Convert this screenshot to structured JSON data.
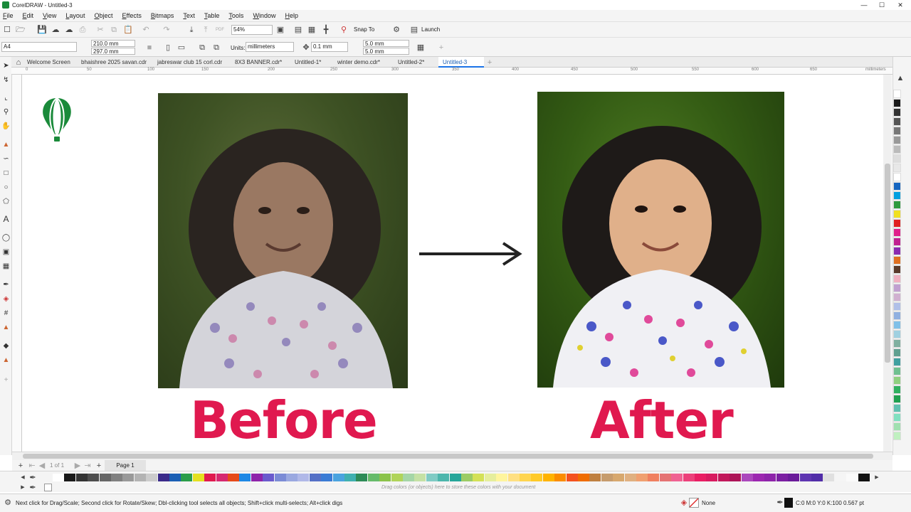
{
  "window": {
    "title": "CorelDRAW - Untitled-3",
    "min": "—",
    "max": "☐",
    "close": "✕"
  },
  "menu": [
    "File",
    "Edit",
    "View",
    "Layout",
    "Object",
    "Effects",
    "Bitmaps",
    "Text",
    "Table",
    "Tools",
    "Window",
    "Help"
  ],
  "stdbar": {
    "zoom": "54%",
    "snap_to": "Snap To",
    "launch": "Launch"
  },
  "propbar": {
    "page_size": "A4",
    "width": "210.0 mm",
    "height": "297.0 mm",
    "units_label": "Units:",
    "units": "millimeters",
    "nudge": "0.1 mm",
    "dup_x": "5.0 mm",
    "dup_y": "5.0 mm"
  },
  "tabs": [
    "Welcome Screen",
    "bhaishree 2025 savan.cdr",
    "jabreswar club 15 corl.cdr",
    "8X3 BANNER.cdr*",
    "Untitled-1*",
    "winter demo.cdr*",
    "Untitled-2*",
    "Untitled-3"
  ],
  "ruler": {
    "ticks": [
      "0",
      "50",
      "100",
      "150",
      "200",
      "250",
      "300",
      "350",
      "400",
      "450",
      "500",
      "550",
      "600",
      "650"
    ],
    "units": "millimeters"
  },
  "canvas": {
    "before": "Before",
    "after": "After"
  },
  "pagebar": {
    "counter": "1 of 1",
    "page": "Page 1"
  },
  "palette_hint": "Drag colors (or objects) here to store these colors with your document",
  "status": {
    "hint": "Next click for Drag/Scale; Second click for Rotate/Skew; Dbl-clicking tool selects all objects; Shift+click multi-selects; Alt+click digs",
    "fill": "None",
    "outline": "C:0 M:0 Y:0 K:100  0.567 pt"
  },
  "colors": {
    "accent": "#e0194f",
    "tab_active": "#1a73e8",
    "logo": "#1a8a3a"
  },
  "palette": [
    "#ffffff",
    "#1a1a1a",
    "#333333",
    "#4d4d4d",
    "#666666",
    "#808080",
    "#999999",
    "#b3b3b3",
    "#cccccc",
    "#3a2a8a",
    "#1a5fb4",
    "#2a9d4a",
    "#e5e020",
    "#e0194f",
    "#d62870",
    "#e64a19",
    "#1e88e5",
    "#8e24aa",
    "#6a5acd",
    "#7b8bd6",
    "#9aa8e0",
    "#b0b8e8",
    "#5470c6",
    "#3a7bd5",
    "#4aa3df",
    "#40b0b0",
    "#2e8b57",
    "#66bb6a",
    "#8bc34a",
    "#b0d45a",
    "#a5d6a7",
    "#c5e1a5",
    "#80cbc4",
    "#4db6ac",
    "#26a69a",
    "#9ccc65",
    "#d4e157",
    "#e6ee9c",
    "#fff59d",
    "#ffe082",
    "#ffd54f",
    "#ffca28",
    "#ffb300",
    "#fb8c00",
    "#f4511e",
    "#ef6c00",
    "#bf8040",
    "#c69c6d",
    "#d7a86e",
    "#e0b080",
    "#f0a070",
    "#f08060",
    "#e57373",
    "#f06292",
    "#ec407a",
    "#e91e63",
    "#d81b60",
    "#c2185b",
    "#ad1457",
    "#ab47bc",
    "#9c27b0",
    "#8e24aa",
    "#7b1fa2",
    "#6a1b9a",
    "#5e35b1",
    "#512da8",
    "#e0e0e0",
    "#f5f5f5",
    "#fafafa",
    "#111111"
  ],
  "side_palette": [
    "#ffffff",
    "#1a1a1a",
    "#333333",
    "#555555",
    "#777777",
    "#999999",
    "#bbbbbb",
    "#dddddd",
    "#e8e8e8",
    "#ffffff",
    "#1565c0",
    "#00a0e0",
    "#2e9a3e",
    "#f0e020",
    "#e02020",
    "#e0208a",
    "#c02090",
    "#8a2ab0",
    "#e07020",
    "#5a3a2a",
    "#f0b0c0",
    "#c0a0d0",
    "#d0b0d0",
    "#b0c0e8",
    "#90b0e0",
    "#80c0e8",
    "#a0d0e0",
    "#80b0a0",
    "#60a090",
    "#40a0a0",
    "#70c090",
    "#90d080",
    "#30b060",
    "#20a050",
    "#60c0b0",
    "#80e0c0",
    "#a0e0b0",
    "#c0f0c0"
  ],
  "stars_note": ""
}
